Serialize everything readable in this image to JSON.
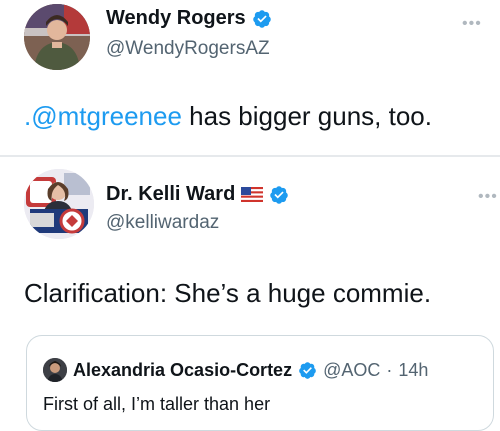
{
  "tweet1": {
    "name": "Wendy Rogers",
    "handle": "@WendyRogersAZ",
    "more_label": "•••",
    "mention": ".@mtgreenee",
    "text_rest": " has bigger guns, too.",
    "avatar": "avatar-wendy-rogers",
    "badge": "verified-badge-icon"
  },
  "tweet2": {
    "name": "Dr. Kelli Ward",
    "flag": "us-flag-icon",
    "handle": "@kelliwardaz",
    "more_label": "•••",
    "text": "Clarification: She’s a huge commie.",
    "avatar": "avatar-kelli-ward",
    "badge": "verified-badge-icon"
  },
  "quoted": {
    "name": "Alexandria Ocasio-Cortez",
    "handle": "@AOC",
    "separator": "·",
    "time": "14h",
    "text": "First of all, I’m taller than her",
    "badge": "verified-badge-icon"
  },
  "colors": {
    "verified": "#1d9bf0",
    "mention": "#1d9bf0",
    "secondary_text": "#536471",
    "border": "#cfd9de"
  }
}
